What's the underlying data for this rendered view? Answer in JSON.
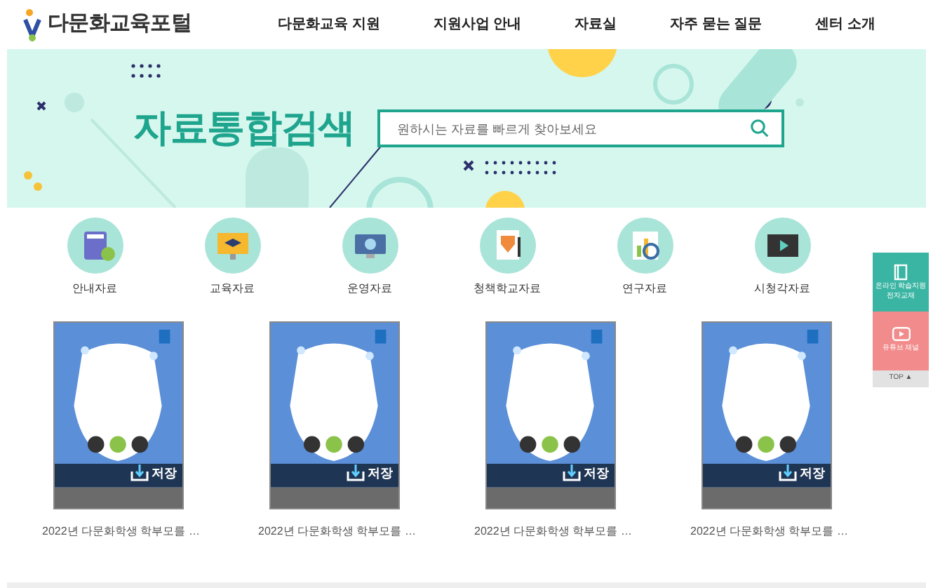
{
  "header": {
    "logo": "다문화교육포털",
    "nav": [
      "다문화교육 지원",
      "지원사업 안내",
      "자료실",
      "자주 묻는 질문",
      "센터 소개"
    ]
  },
  "banner": {
    "title": "자료통합검색",
    "search": {
      "placeholder": "원하시는 자료를 빠르게 찾아보세요"
    }
  },
  "categories": [
    {
      "label": "안내자료",
      "kind": "book"
    },
    {
      "label": "교육자료",
      "kind": "monitor"
    },
    {
      "label": "운영자료",
      "kind": "screen"
    },
    {
      "label": "청책학교자료",
      "kind": "shield"
    },
    {
      "label": "연구자료",
      "kind": "chart"
    },
    {
      "label": "시청각자료",
      "kind": "video"
    }
  ],
  "materials": [
    {
      "title": "2022년 다문화학생 학부모를 …",
      "save": "저장",
      "kind": "picture"
    },
    {
      "title": "2022년 다문화학생 학부모를 …",
      "save": "저장",
      "kind": "picture"
    },
    {
      "title": "2022년 다문화학생 학부모를 …",
      "save": "저장",
      "kind": "picture"
    },
    {
      "title": "2022년 다문화학생 학부모를 …",
      "save": "저장",
      "kind": "picture"
    }
  ],
  "side": {
    "ebook": "온라인 학습지원 전자교재",
    "youtube": "유튜브 채널",
    "top": "TOP ▲"
  }
}
